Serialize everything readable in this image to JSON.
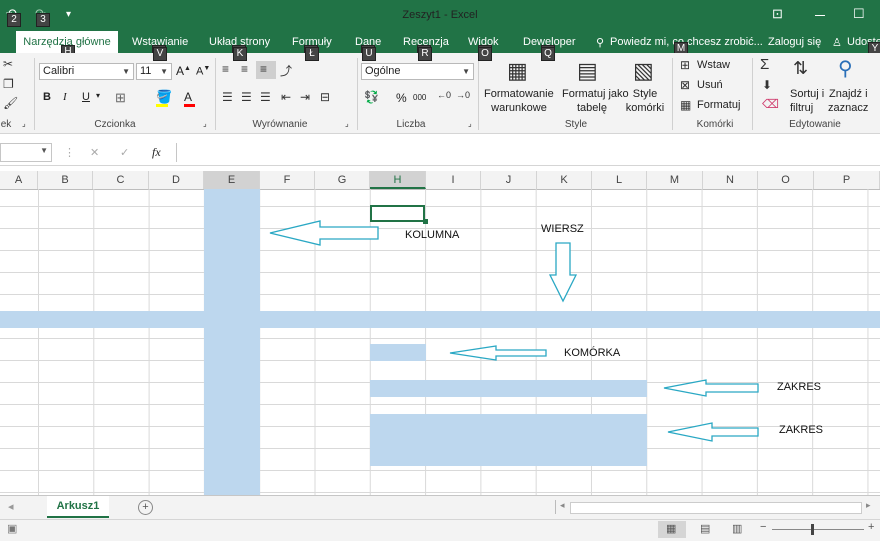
{
  "window": {
    "title": "Zeszyt1 - Excel",
    "qat_keytips": [
      "2",
      "3"
    ],
    "ribbon_toggle": "⊡",
    "restore": "☐"
  },
  "tabs": [
    {
      "label": "Narzędzia główne",
      "keytip": "H"
    },
    {
      "label": "Wstawianie",
      "keytip": "V"
    },
    {
      "label": "Układ strony",
      "keytip": "K"
    },
    {
      "label": "Formuły",
      "keytip": "Ł"
    },
    {
      "label": "Dane",
      "keytip": "U"
    },
    {
      "label": "Recenzja",
      "keytip": "R"
    },
    {
      "label": "Widok",
      "keytip": "O"
    },
    {
      "label": "Deweloper",
      "keytip": "Q"
    }
  ],
  "tell_me": "Powiedz mi, co chcesz zrobić...",
  "tell_me_keytip": "M",
  "sign_in": "Zaloguj się",
  "share": "Udostę",
  "share_keytip": "Y",
  "ribbon": {
    "font_name": "Calibri",
    "font_size": "11",
    "number_format": "Ogólne",
    "conditional_formatting": [
      "Formatowanie",
      "warunkowe"
    ],
    "format_table": [
      "Formatuj jako",
      "tabelę"
    ],
    "cell_styles": [
      "Style",
      "komórki"
    ],
    "insert": "Wstaw",
    "delete": "Usuń",
    "format": "Formatuj",
    "sort_filter": [
      "Sortuj i",
      "filtruj"
    ],
    "find_select": [
      "Znajdź i",
      "zaznacz"
    ],
    "groups": {
      "clipboard": "ek",
      "font": "Czcionka",
      "alignment": "Wyrównanie",
      "number": "Liczba",
      "styles": "Style",
      "cells": "Komórki",
      "editing": "Edytowanie"
    },
    "num_buttons": [
      "%",
      "000"
    ]
  },
  "formula_bar": {
    "fx": "fx",
    "cancel": "✕",
    "enter": "✓",
    "value": ""
  },
  "columns": [
    "A",
    "B",
    "C",
    "D",
    "E",
    "F",
    "G",
    "H",
    "I",
    "J",
    "K",
    "L",
    "M",
    "N",
    "O",
    "P"
  ],
  "annotations": {
    "kolumna": "KOLUMNA",
    "wiersz": "WIERSZ",
    "komorka": "KOMÓRKA",
    "zakres1": "ZAKRES",
    "zakres2": "ZAKRES"
  },
  "sheet": {
    "name": "Arkusz1",
    "add": "+"
  },
  "colors": {
    "brand": "#217346",
    "highlight": "#bdd7ee",
    "arrow": "#2aa8c4"
  }
}
